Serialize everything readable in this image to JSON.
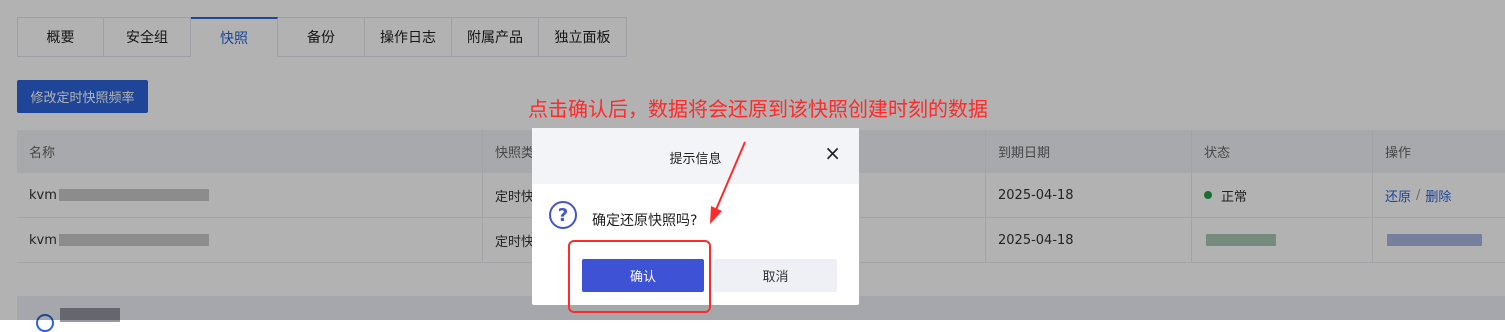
{
  "tabs": [
    "概要",
    "安全组",
    "快照",
    "备份",
    "操作日志",
    "附属产品",
    "独立面板"
  ],
  "active_tab": "快照",
  "toolbar": {
    "modify_button": "修改定时快照频率"
  },
  "table": {
    "headers": [
      "名称",
      "快照类",
      "到期日期",
      "状态",
      "操作"
    ],
    "rows": [
      {
        "name": "kvm",
        "type": "定时快",
        "expiry": "2025-04-18",
        "status": "正常",
        "action_restore": "还原",
        "action_sep": "/",
        "action_delete": "删除"
      },
      {
        "name": "kvm",
        "type": "定时快",
        "expiry": "2025-04-18"
      }
    ]
  },
  "annotation": "点击确认后，数据将会还原到该快照创建时刻的数据",
  "dialog": {
    "title": "提示信息",
    "close": "×",
    "question_mark": "?",
    "message": "确定还原快照吗?",
    "confirm": "确认",
    "cancel": "取消"
  },
  "colors": {
    "primary": "#2c64d8",
    "dialog_confirm": "#3d52d4",
    "annotation": "#ff2a2a",
    "status_ok": "#22a04b"
  }
}
